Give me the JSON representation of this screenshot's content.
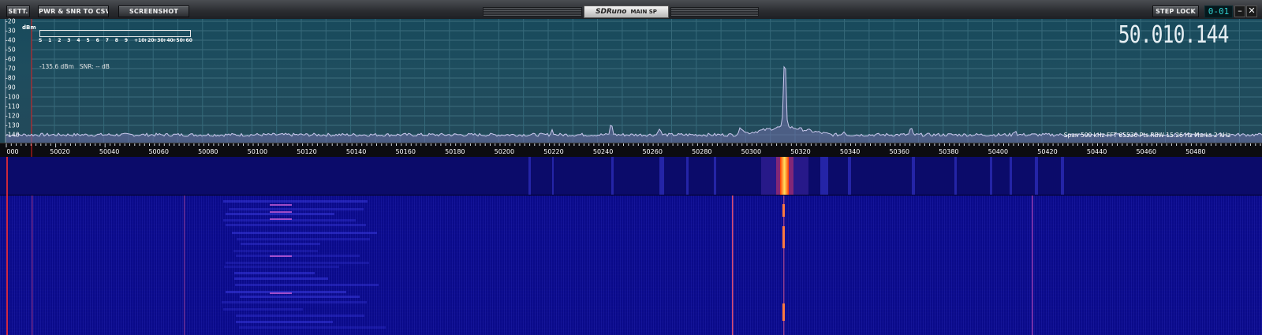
{
  "toolbar": {
    "settings_label": "SETT.",
    "pwr_label": "PWR & SNR TO CSV",
    "screenshot_label": "SCREENSHOT",
    "step_lock_label": "STEP LOCK",
    "step_digits": "0-01"
  },
  "logo": {
    "brand": "SDRuno",
    "panel": "MAIN SP"
  },
  "spectrum": {
    "dbm_unit": "dBm",
    "y_ticks": [
      "-20",
      "-30",
      "-40",
      "-50",
      "-60",
      "-70",
      "-80",
      "-90",
      "-100",
      "-110",
      "-120",
      "-130",
      "-140"
    ],
    "smeter_scale": [
      "S",
      "1",
      "2",
      "3",
      "4",
      "5",
      "6",
      "7",
      "8",
      "9",
      "+10",
      "+20",
      "+30",
      "+40",
      "+50",
      "+60"
    ],
    "readout": "-135.6 dBm   SNR: -- dB",
    "frequency": "50.010.144",
    "info": "Span 500 kHz   FFT 65536 Pts   RBW 15.26 Hz   Marks 2 kHz"
  },
  "ruler": {
    "labels": [
      "000",
      "50020",
      "50040",
      "50060",
      "50080",
      "50100",
      "50120",
      "50140",
      "50160",
      "50180",
      "50200",
      "50220",
      "50240",
      "50260",
      "50280",
      "50300",
      "50320",
      "50340",
      "50360",
      "50380",
      "50400",
      "50420",
      "50440",
      "50460",
      "50480"
    ]
  },
  "colors": {
    "spectrum_bg": "#1e4d5e",
    "trace": "#c8c8ec",
    "waterfall_bg": "#0a0a8a",
    "signal_hot": "#ffe060",
    "marker_red": "#e02020"
  }
}
